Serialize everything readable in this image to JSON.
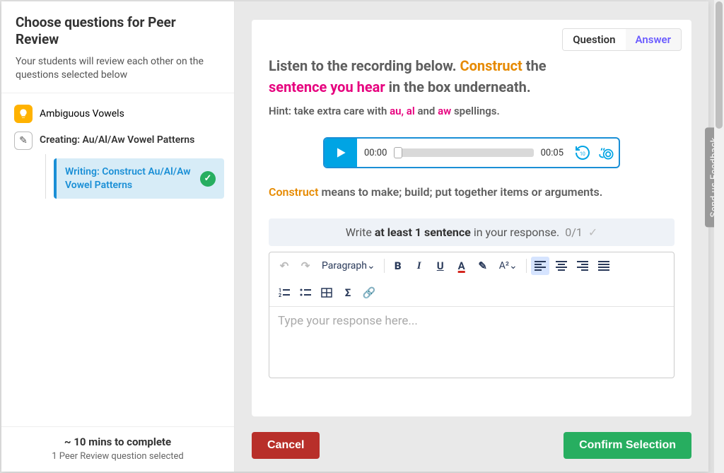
{
  "sidebar": {
    "title": "Choose questions for Peer Review",
    "subtitle": "Your students will review each other on the questions selected below",
    "tree": {
      "section_label": "Ambiguous Vowels",
      "subsection_label": "Creating: Au/Al/Aw Vowel Patterns",
      "item_label": "Writing: Construct Au/Al/Aw Vowel Patterns"
    },
    "footer": {
      "time": "~ 10 mins to complete",
      "count": "1 Peer Review question selected"
    }
  },
  "toggle": {
    "question": "Question",
    "answer": "Answer"
  },
  "prompt": {
    "line1_a": "Listen to the recording below. ",
    "line1_b": "Construct",
    "line1_c": " the ",
    "line2_a": "sentence you hear",
    "line2_b": " in the box underneath."
  },
  "hint": {
    "prefix": "Hint: take extra care with ",
    "h1": "au, al",
    "mid": " and ",
    "h2": "aw",
    "suffix": " spellings."
  },
  "audio": {
    "current": "00:00",
    "total": "00:05",
    "rewind_num": "10"
  },
  "definition": {
    "word": "Construct",
    "rest": " means to make; build; put together items or arguments."
  },
  "response_bar": {
    "a": "Write ",
    "b": "at least 1 sentence",
    "c": " in your response. ",
    "count": "0/1"
  },
  "editor": {
    "paragraph_label": "Paragraph",
    "placeholder": "Type your response here..."
  },
  "buttons": {
    "cancel": "Cancel",
    "confirm": "Confirm Selection"
  },
  "feedback_tab": "Send us Feedback"
}
